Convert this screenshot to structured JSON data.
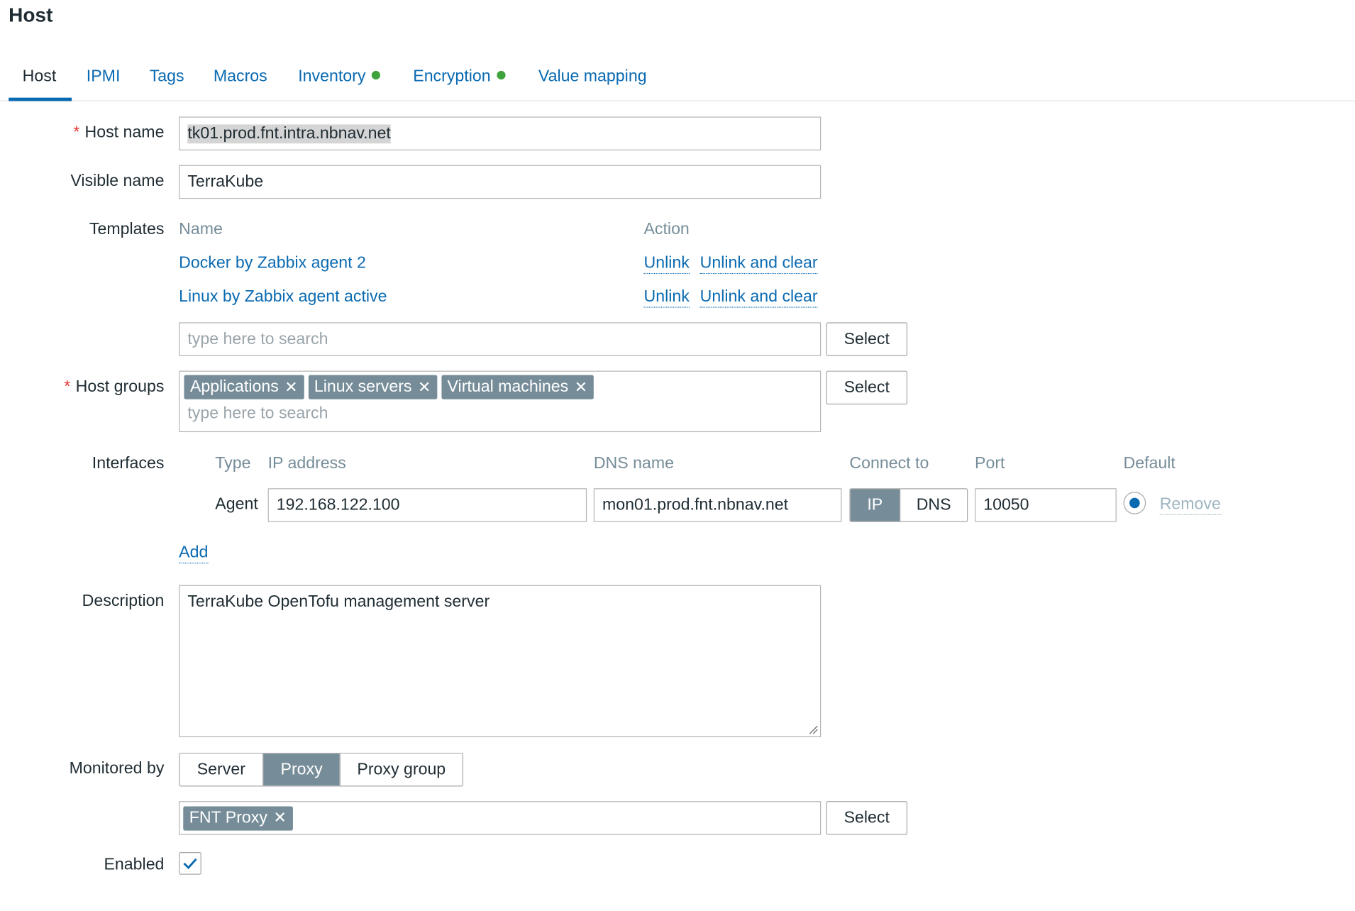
{
  "page_title": "Host",
  "tabs": [
    {
      "label": "Host",
      "active": true
    },
    {
      "label": "IPMI"
    },
    {
      "label": "Tags"
    },
    {
      "label": "Macros"
    },
    {
      "label": "Inventory",
      "indicator": "green-dot"
    },
    {
      "label": "Encryption",
      "indicator": "green-dot"
    },
    {
      "label": "Value mapping"
    }
  ],
  "colors": {
    "link": "#0a6ab1",
    "indicator": "#3ea33a",
    "required": "#e33734",
    "chip": "#768d99"
  },
  "form": {
    "required_mark": "*",
    "host_name": {
      "label": "Host name",
      "value": "tk01.prod.fnt.intra.nbnav.net"
    },
    "visible_name": {
      "label": "Visible name",
      "value": "TerraKube"
    },
    "templates": {
      "label": "Templates",
      "col_name": "Name",
      "col_action": "Action",
      "items": [
        {
          "name": "Docker by Zabbix agent 2",
          "unlink": "Unlink",
          "unlink_clear": "Unlink and clear"
        },
        {
          "name": "Linux by Zabbix agent active",
          "unlink": "Unlink",
          "unlink_clear": "Unlink and clear"
        }
      ],
      "search_placeholder": "type here to search",
      "select_label": "Select"
    },
    "host_groups": {
      "label": "Host groups",
      "chips": [
        "Applications",
        "Linux servers",
        "Virtual machines"
      ],
      "search_placeholder": "type here to search",
      "select_label": "Select"
    },
    "interfaces": {
      "label": "Interfaces",
      "headers": {
        "type": "Type",
        "ip": "IP address",
        "dns": "DNS name",
        "connect": "Connect to",
        "port": "Port",
        "default": "Default"
      },
      "rows": [
        {
          "type": "Agent",
          "ip": "192.168.122.100",
          "dns": "mon01.prod.fnt.nbnav.net",
          "connect_ip": "IP",
          "connect_dns": "DNS",
          "connect_selected": "IP",
          "port": "10050",
          "default": true,
          "remove": "Remove"
        }
      ],
      "add_label": "Add"
    },
    "description": {
      "label": "Description",
      "value": "TerraKube OpenTofu management server"
    },
    "monitored_by": {
      "label": "Monitored by",
      "options": [
        "Server",
        "Proxy",
        "Proxy group"
      ],
      "selected": "Proxy",
      "proxy_chip": "FNT Proxy",
      "select_label": "Select"
    },
    "enabled": {
      "label": "Enabled",
      "checked": true
    }
  }
}
